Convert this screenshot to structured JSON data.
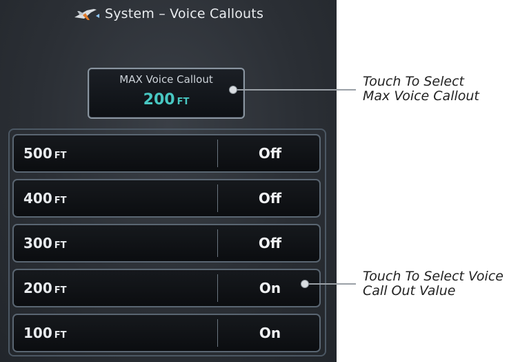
{
  "header": {
    "title": "System – Voice Callouts"
  },
  "max_voice_callout": {
    "label": "MAX Voice Callout",
    "value": "200",
    "unit": "FT"
  },
  "callouts": [
    {
      "altitude": "500",
      "unit": "FT",
      "state": "Off"
    },
    {
      "altitude": "400",
      "unit": "FT",
      "state": "Off"
    },
    {
      "altitude": "300",
      "unit": "FT",
      "state": "Off"
    },
    {
      "altitude": "200",
      "unit": "FT",
      "state": "On"
    },
    {
      "altitude": "100",
      "unit": "FT",
      "state": "On"
    }
  ],
  "annotations": {
    "max": {
      "line1": "Touch To Select",
      "line2": "Max Voice Callout"
    },
    "value": {
      "line1": "Touch To Select Voice",
      "line2": "Call Out Value"
    }
  },
  "colors": {
    "value_accent": "#48c7c2",
    "background": "#2b2f35"
  }
}
